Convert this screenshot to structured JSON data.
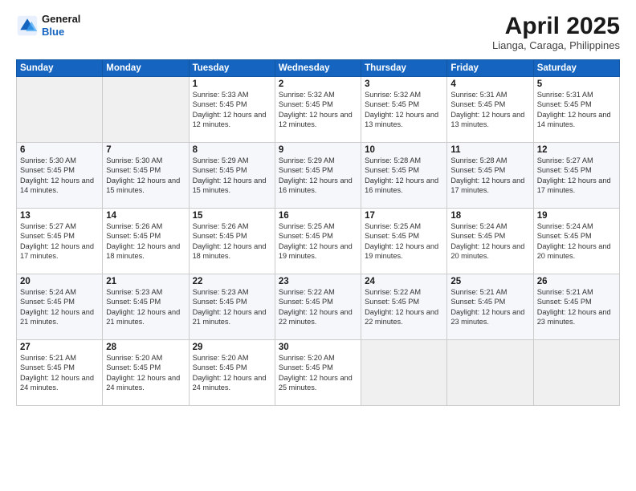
{
  "logo": {
    "line1": "General",
    "line2": "Blue"
  },
  "title": "April 2025",
  "subtitle": "Lianga, Caraga, Philippines",
  "weekdays": [
    "Sunday",
    "Monday",
    "Tuesday",
    "Wednesday",
    "Thursday",
    "Friday",
    "Saturday"
  ],
  "weeks": [
    [
      {
        "day": "",
        "sunrise": "",
        "sunset": "",
        "daylight": ""
      },
      {
        "day": "",
        "sunrise": "",
        "sunset": "",
        "daylight": ""
      },
      {
        "day": "1",
        "sunrise": "Sunrise: 5:33 AM",
        "sunset": "Sunset: 5:45 PM",
        "daylight": "Daylight: 12 hours and 12 minutes."
      },
      {
        "day": "2",
        "sunrise": "Sunrise: 5:32 AM",
        "sunset": "Sunset: 5:45 PM",
        "daylight": "Daylight: 12 hours and 12 minutes."
      },
      {
        "day": "3",
        "sunrise": "Sunrise: 5:32 AM",
        "sunset": "Sunset: 5:45 PM",
        "daylight": "Daylight: 12 hours and 13 minutes."
      },
      {
        "day": "4",
        "sunrise": "Sunrise: 5:31 AM",
        "sunset": "Sunset: 5:45 PM",
        "daylight": "Daylight: 12 hours and 13 minutes."
      },
      {
        "day": "5",
        "sunrise": "Sunrise: 5:31 AM",
        "sunset": "Sunset: 5:45 PM",
        "daylight": "Daylight: 12 hours and 14 minutes."
      }
    ],
    [
      {
        "day": "6",
        "sunrise": "Sunrise: 5:30 AM",
        "sunset": "Sunset: 5:45 PM",
        "daylight": "Daylight: 12 hours and 14 minutes."
      },
      {
        "day": "7",
        "sunrise": "Sunrise: 5:30 AM",
        "sunset": "Sunset: 5:45 PM",
        "daylight": "Daylight: 12 hours and 15 minutes."
      },
      {
        "day": "8",
        "sunrise": "Sunrise: 5:29 AM",
        "sunset": "Sunset: 5:45 PM",
        "daylight": "Daylight: 12 hours and 15 minutes."
      },
      {
        "day": "9",
        "sunrise": "Sunrise: 5:29 AM",
        "sunset": "Sunset: 5:45 PM",
        "daylight": "Daylight: 12 hours and 16 minutes."
      },
      {
        "day": "10",
        "sunrise": "Sunrise: 5:28 AM",
        "sunset": "Sunset: 5:45 PM",
        "daylight": "Daylight: 12 hours and 16 minutes."
      },
      {
        "day": "11",
        "sunrise": "Sunrise: 5:28 AM",
        "sunset": "Sunset: 5:45 PM",
        "daylight": "Daylight: 12 hours and 17 minutes."
      },
      {
        "day": "12",
        "sunrise": "Sunrise: 5:27 AM",
        "sunset": "Sunset: 5:45 PM",
        "daylight": "Daylight: 12 hours and 17 minutes."
      }
    ],
    [
      {
        "day": "13",
        "sunrise": "Sunrise: 5:27 AM",
        "sunset": "Sunset: 5:45 PM",
        "daylight": "Daylight: 12 hours and 17 minutes."
      },
      {
        "day": "14",
        "sunrise": "Sunrise: 5:26 AM",
        "sunset": "Sunset: 5:45 PM",
        "daylight": "Daylight: 12 hours and 18 minutes."
      },
      {
        "day": "15",
        "sunrise": "Sunrise: 5:26 AM",
        "sunset": "Sunset: 5:45 PM",
        "daylight": "Daylight: 12 hours and 18 minutes."
      },
      {
        "day": "16",
        "sunrise": "Sunrise: 5:25 AM",
        "sunset": "Sunset: 5:45 PM",
        "daylight": "Daylight: 12 hours and 19 minutes."
      },
      {
        "day": "17",
        "sunrise": "Sunrise: 5:25 AM",
        "sunset": "Sunset: 5:45 PM",
        "daylight": "Daylight: 12 hours and 19 minutes."
      },
      {
        "day": "18",
        "sunrise": "Sunrise: 5:24 AM",
        "sunset": "Sunset: 5:45 PM",
        "daylight": "Daylight: 12 hours and 20 minutes."
      },
      {
        "day": "19",
        "sunrise": "Sunrise: 5:24 AM",
        "sunset": "Sunset: 5:45 PM",
        "daylight": "Daylight: 12 hours and 20 minutes."
      }
    ],
    [
      {
        "day": "20",
        "sunrise": "Sunrise: 5:24 AM",
        "sunset": "Sunset: 5:45 PM",
        "daylight": "Daylight: 12 hours and 21 minutes."
      },
      {
        "day": "21",
        "sunrise": "Sunrise: 5:23 AM",
        "sunset": "Sunset: 5:45 PM",
        "daylight": "Daylight: 12 hours and 21 minutes."
      },
      {
        "day": "22",
        "sunrise": "Sunrise: 5:23 AM",
        "sunset": "Sunset: 5:45 PM",
        "daylight": "Daylight: 12 hours and 21 minutes."
      },
      {
        "day": "23",
        "sunrise": "Sunrise: 5:22 AM",
        "sunset": "Sunset: 5:45 PM",
        "daylight": "Daylight: 12 hours and 22 minutes."
      },
      {
        "day": "24",
        "sunrise": "Sunrise: 5:22 AM",
        "sunset": "Sunset: 5:45 PM",
        "daylight": "Daylight: 12 hours and 22 minutes."
      },
      {
        "day": "25",
        "sunrise": "Sunrise: 5:21 AM",
        "sunset": "Sunset: 5:45 PM",
        "daylight": "Daylight: 12 hours and 23 minutes."
      },
      {
        "day": "26",
        "sunrise": "Sunrise: 5:21 AM",
        "sunset": "Sunset: 5:45 PM",
        "daylight": "Daylight: 12 hours and 23 minutes."
      }
    ],
    [
      {
        "day": "27",
        "sunrise": "Sunrise: 5:21 AM",
        "sunset": "Sunset: 5:45 PM",
        "daylight": "Daylight: 12 hours and 24 minutes."
      },
      {
        "day": "28",
        "sunrise": "Sunrise: 5:20 AM",
        "sunset": "Sunset: 5:45 PM",
        "daylight": "Daylight: 12 hours and 24 minutes."
      },
      {
        "day": "29",
        "sunrise": "Sunrise: 5:20 AM",
        "sunset": "Sunset: 5:45 PM",
        "daylight": "Daylight: 12 hours and 24 minutes."
      },
      {
        "day": "30",
        "sunrise": "Sunrise: 5:20 AM",
        "sunset": "Sunset: 5:45 PM",
        "daylight": "Daylight: 12 hours and 25 minutes."
      },
      {
        "day": "",
        "sunrise": "",
        "sunset": "",
        "daylight": ""
      },
      {
        "day": "",
        "sunrise": "",
        "sunset": "",
        "daylight": ""
      },
      {
        "day": "",
        "sunrise": "",
        "sunset": "",
        "daylight": ""
      }
    ]
  ]
}
